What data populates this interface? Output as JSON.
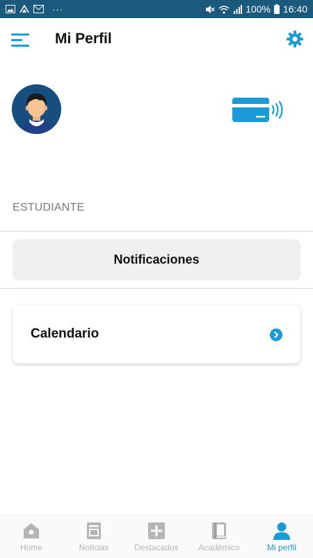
{
  "statusbar": {
    "battery": "100%",
    "time": "16:40",
    "more": "···",
    "icons": [
      "image-icon",
      "cast-icon",
      "mail-icon",
      "mute-icon",
      "wifi-icon",
      "signal-icon",
      "battery-icon"
    ]
  },
  "header": {
    "title": "Mi Perfil",
    "menu_icon": "menu-icon",
    "settings_icon": "gear-icon"
  },
  "profile": {
    "role": "ESTUDIANTE",
    "avatar_icon": "avatar",
    "card_icon": "nfc-card-icon"
  },
  "actions": {
    "notifications_label": "Notificaciones",
    "calendar_label": "Calendario"
  },
  "bottom_nav": {
    "items": [
      {
        "label": "Home",
        "icon": "home-icon",
        "active": false
      },
      {
        "label": "Noticias",
        "icon": "news-icon",
        "active": false
      },
      {
        "label": "Destacados",
        "icon": "plus-icon",
        "active": false
      },
      {
        "label": "Académico",
        "icon": "book-icon",
        "active": false
      },
      {
        "label": "Mi perfil",
        "icon": "person-icon",
        "active": true
      }
    ]
  },
  "colors": {
    "statusbar": "#1b5a7d",
    "accent": "#1a9ad6",
    "inactive": "#b5b5b5",
    "avatar_bg": "#164e7f"
  }
}
